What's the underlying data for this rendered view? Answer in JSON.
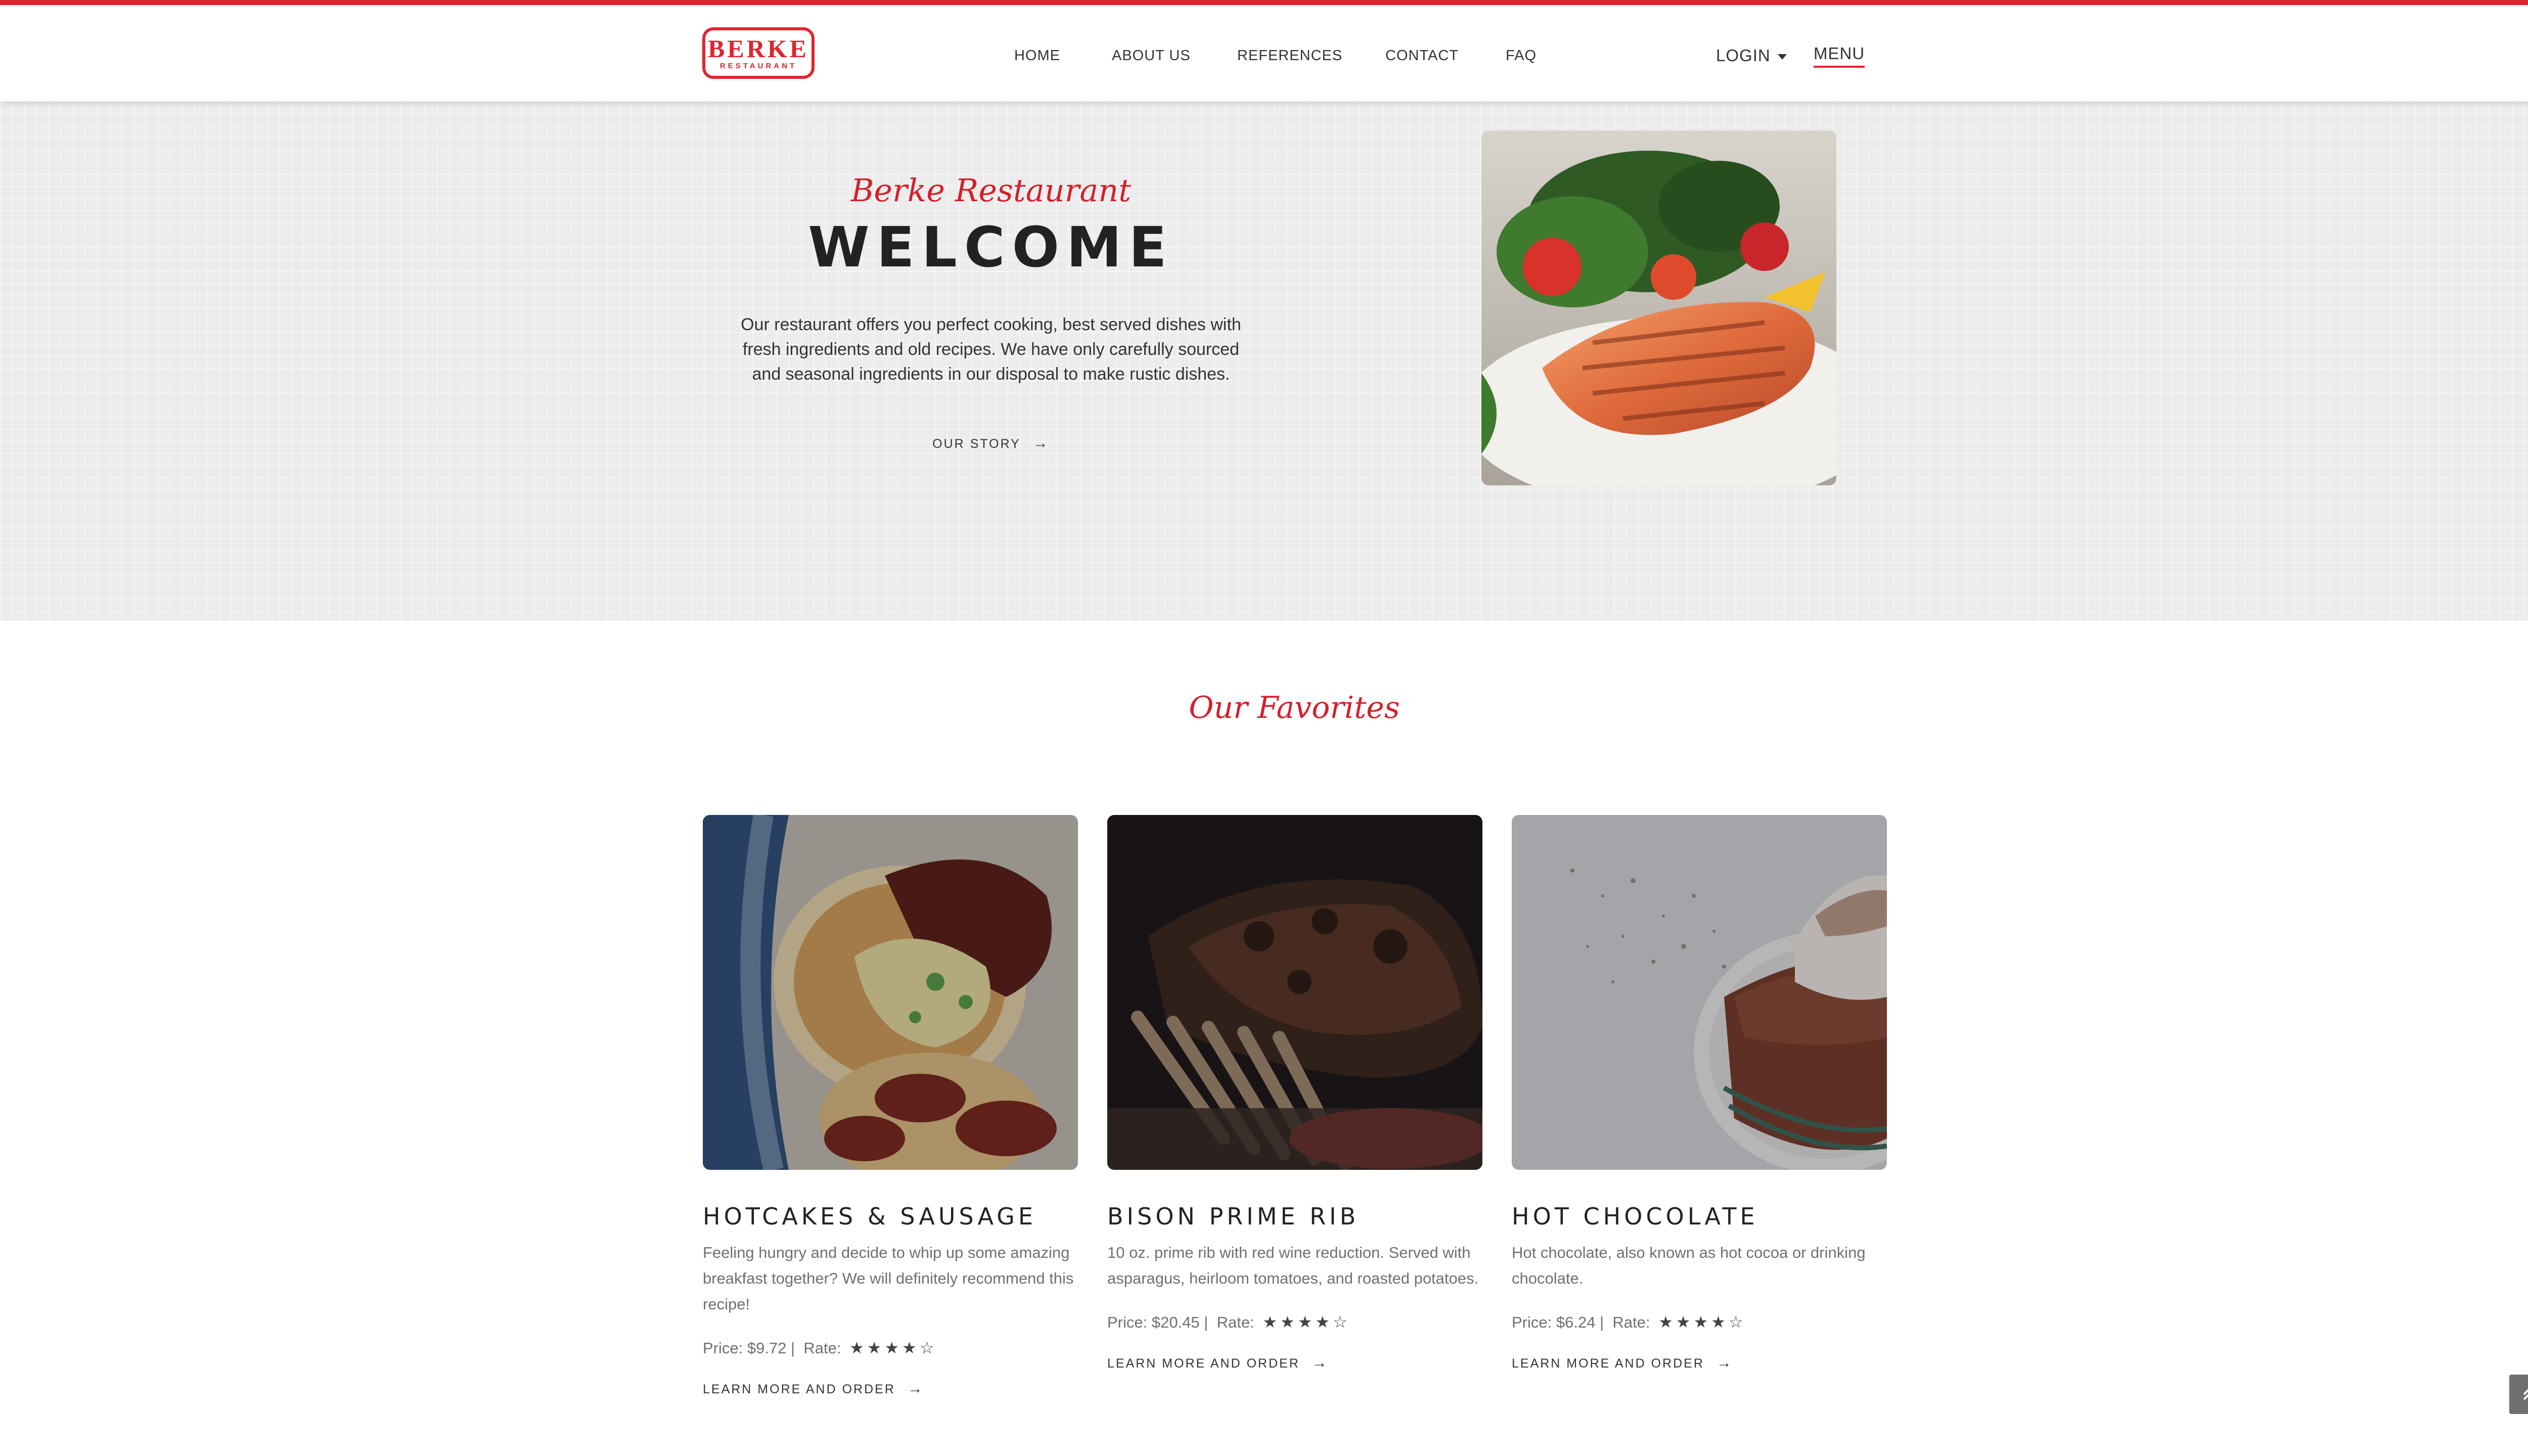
{
  "brand": {
    "logo_main": "BERKE",
    "logo_sub": "RESTAURANT",
    "accent": "#e0242f"
  },
  "nav": {
    "items": [
      {
        "label": "HOME"
      },
      {
        "label": "ABOUT US"
      },
      {
        "label": "REFERENCES"
      },
      {
        "label": "CONTACT"
      },
      {
        "label": "FAQ"
      }
    ],
    "login": "LOGIN",
    "menu": "MENU"
  },
  "hero": {
    "subtitle": "Berke Restaurant",
    "title": "WELCOME",
    "text": "Our restaurant offers you perfect cooking, best served dishes with fresh ingredients and old recipes. We have only carefully sourced and seasonal ingredients in our disposal to make rustic dishes.",
    "link": "OUR STORY",
    "photo_icon": "grilled-salmon-photo"
  },
  "favorites": {
    "title": "Our Favorites",
    "items": [
      {
        "title": "HOTCAKES & SAUSAGE",
        "description": "Feeling hungry and decide to whip up some amazing breakfast together? We will definitely recommend this recipe!",
        "price_label": "Price: $9.72 |",
        "rate_label": "Rate:",
        "rating": 4,
        "rating_max": 5,
        "link": "LEARN MORE AND ORDER"
      },
      {
        "title": "BISON PRIME RIB",
        "description": "10 oz. prime rib with red wine reduction. Served with asparagus, heirloom tomatoes, and roasted potatoes.",
        "price_label": "Price: $20.45 |",
        "rate_label": "Rate:",
        "rating": 4,
        "rating_max": 5,
        "link": "LEARN MORE AND ORDER"
      },
      {
        "title": "HOT CHOCOLATE",
        "description": "Hot chocolate, also known as hot cocoa or drinking chocolate.",
        "price_label": "Price: $6.24 |",
        "rate_label": "Rate:",
        "rating": 4,
        "rating_max": 5,
        "link": "LEARN MORE AND ORDER"
      }
    ]
  }
}
